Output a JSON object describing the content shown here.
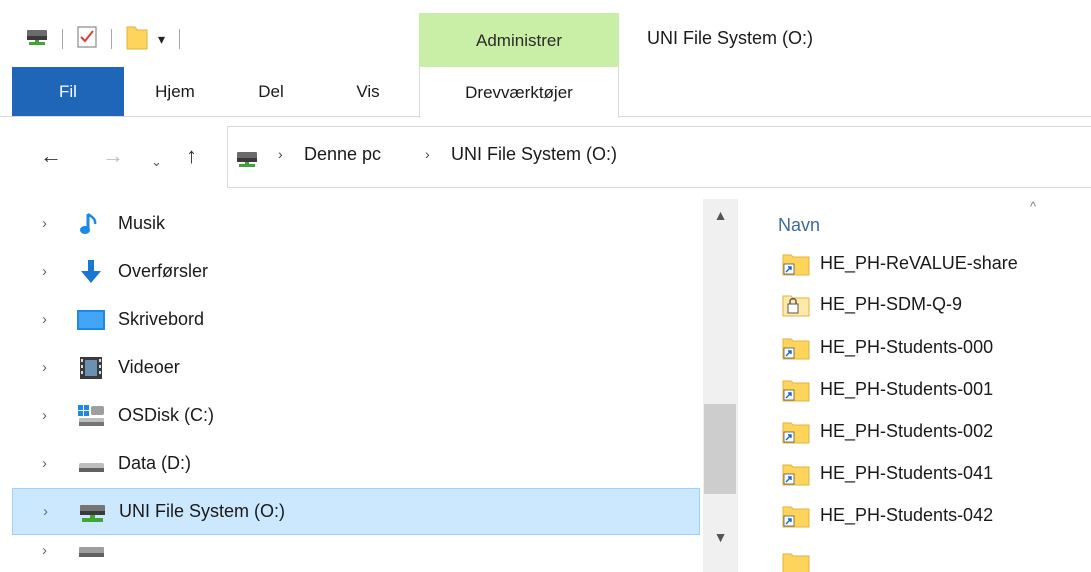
{
  "window": {
    "title": "UNI File System (O:)",
    "context_tab_header": "Administrer"
  },
  "ribbon": {
    "tabs": [
      {
        "label": "Fil",
        "icon": "none"
      },
      {
        "label": "Hjem"
      },
      {
        "label": "Del"
      },
      {
        "label": "Vis"
      },
      {
        "label": "Drevværktøjer"
      }
    ],
    "accent_color": "#1f66b8",
    "context_color": "#c9eea5"
  },
  "quick_access": {
    "icons": [
      "network-drive-icon",
      "properties-check-icon",
      "new-folder-icon",
      "customize-dropdown-icon"
    ]
  },
  "navigation": {
    "back_icon": "arrow-left-icon",
    "forward_icon": "arrow-right-icon",
    "recent_icon": "chevron-down-icon",
    "up_icon": "arrow-up-icon"
  },
  "address": {
    "breadcrumbs": [
      "Denne pc",
      "UNI File System (O:)"
    ]
  },
  "tree": {
    "items": [
      {
        "label": "Musik",
        "icon": "music-icon"
      },
      {
        "label": "Overførsler",
        "icon": "downloads-icon"
      },
      {
        "label": "Skrivebord",
        "icon": "desktop-icon"
      },
      {
        "label": "Videoer",
        "icon": "videos-icon"
      },
      {
        "label": "OSDisk (C:)",
        "icon": "windows-drive-icon"
      },
      {
        "label": "Data (D:)",
        "icon": "drive-icon"
      },
      {
        "label": "UNI File System (O:)",
        "icon": "network-drive-icon",
        "selected": true
      }
    ]
  },
  "files": {
    "column_header": "Navn",
    "items": [
      {
        "name": "HE_PH-ReVALUE-share",
        "icon": "shared-folder-icon"
      },
      {
        "name": "HE_PH-SDM-Q-9",
        "icon": "locked-folder-icon"
      },
      {
        "name": "HE_PH-Students-000",
        "icon": "shared-folder-icon"
      },
      {
        "name": "HE_PH-Students-001",
        "icon": "shared-folder-icon"
      },
      {
        "name": "HE_PH-Students-002",
        "icon": "shared-folder-icon"
      },
      {
        "name": "HE_PH-Students-041",
        "icon": "shared-folder-icon"
      },
      {
        "name": "HE_PH-Students-042",
        "icon": "shared-folder-icon"
      }
    ]
  }
}
